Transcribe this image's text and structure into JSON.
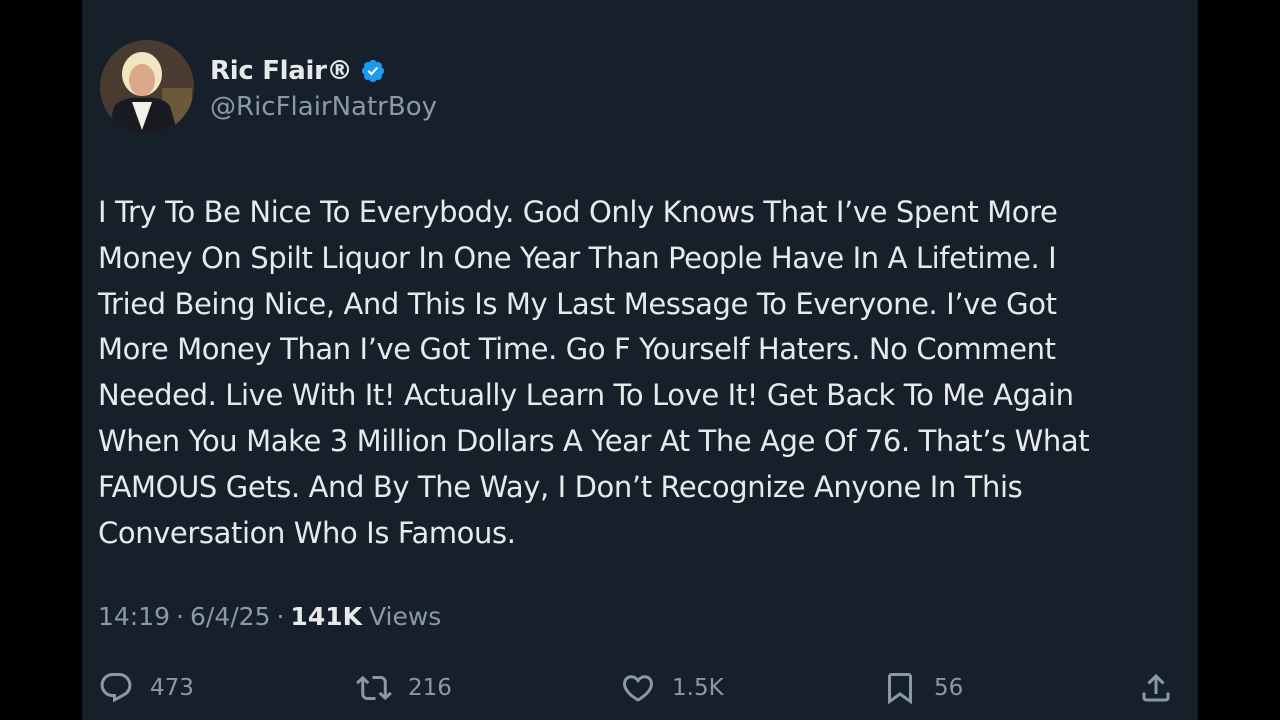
{
  "author": {
    "display_name": "Ric Flair®",
    "handle": "@RicFlairNatrBoy",
    "verified": true,
    "avatar_icon": "profile-photo"
  },
  "tweet": {
    "text": "I Try To Be Nice To Everybody. God Only Knows That I’ve Spent More\nMoney On Spilt Liquor In One Year Than People Have In A Lifetime. I\nTried Being Nice, And This Is My Last Message To Everyone. I’ve Got\nMore Money Than I’ve Got Time. Go F Yourself Haters. No Comment\nNeeded. Live With It! Actually Learn To Love It! Get Back To Me Again\nWhen You Make 3 Million Dollars A Year At The Age Of 76. That’s What\nFAMOUS Gets. And By The Way, I Don’t Recognize Anyone In This\nConversation Who Is Famous."
  },
  "meta": {
    "time": "14:19",
    "separator": "·",
    "date": "6/4/25",
    "views_count": "141K",
    "views_label": "Views"
  },
  "actions": {
    "replies": "473",
    "reposts": "216",
    "likes": "1.5K",
    "bookmarks": "56"
  },
  "colors": {
    "background": "#15202b",
    "text_primary": "#e7e9ea",
    "text_secondary": "#8b98a5",
    "verified_badge": "#1d9bf0"
  }
}
